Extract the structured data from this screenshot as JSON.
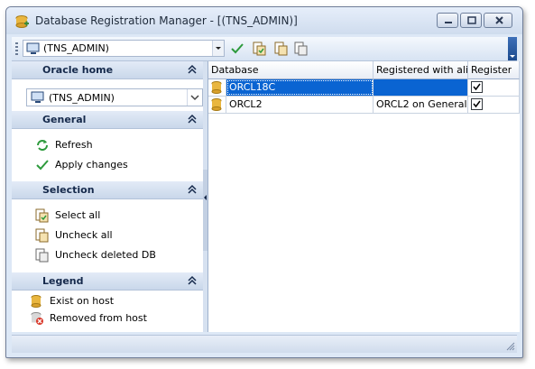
{
  "window": {
    "title": "Database Registration Manager - [(TNS_ADMIN)]"
  },
  "toolbar": {
    "home_value": "(TNS_ADMIN)"
  },
  "sections": {
    "oracle_home": {
      "title": "Oracle home",
      "value": "(TNS_ADMIN)"
    },
    "general": {
      "title": "General",
      "items": [
        "Refresh",
        "Apply changes"
      ]
    },
    "selection": {
      "title": "Selection",
      "items": [
        "Select all",
        "Uncheck all",
        "Uncheck deleted DB"
      ]
    },
    "legend": {
      "title": "Legend",
      "items": [
        "Exist on host",
        "Removed from host"
      ]
    }
  },
  "grid": {
    "columns": [
      "Database",
      "Registered with ali...",
      "Register"
    ],
    "rows": [
      {
        "database": "ORCL18C",
        "alias": "",
        "register": true,
        "selected": true
      },
      {
        "database": "ORCL2",
        "alias": "ORCL2 on General",
        "register": true,
        "selected": false
      }
    ]
  },
  "colors": {
    "selection": "#0a64d2",
    "accent": "#1b4a8d"
  },
  "icons": [
    "app-db-icon",
    "minimize-icon",
    "maximize-icon",
    "close-icon",
    "computer-icon",
    "checkmark-icon",
    "select-all-icon",
    "uncheck-all-icon",
    "uncheck-deleted-icon",
    "refresh-icon",
    "database-icon",
    "removed-database-icon",
    "chevron-up-icon"
  ]
}
